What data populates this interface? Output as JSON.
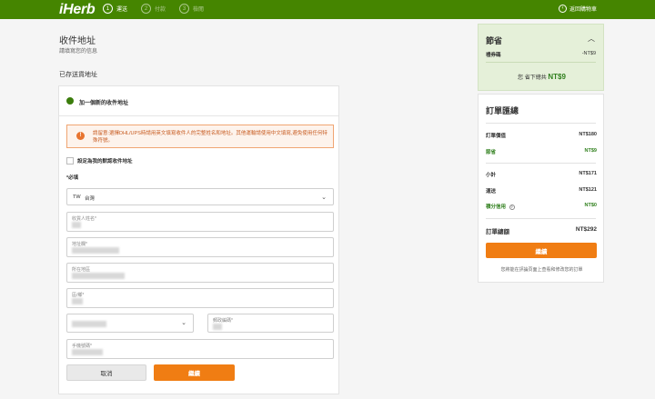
{
  "header": {
    "logo": "iHerb",
    "steps": [
      {
        "num": "1",
        "label": "運送"
      },
      {
        "num": "2",
        "label": "付款"
      },
      {
        "num": "3",
        "label": "檢閱"
      }
    ],
    "back_icon": "‹",
    "back_label": "返回購物車"
  },
  "page": {
    "title": "收件地址",
    "subtitle": "請填寫您的信息",
    "saved_label": "已存送貨地址"
  },
  "form": {
    "add_new_label": "加一個新的收件地址",
    "notice_icon": "!",
    "notice_text": "請留意:選擇DHL/UPS時請用英文填寫收件人的完整姓名和地址。其他運輸請使用中文填寫,避免使用任何特殊符號。",
    "default_label": "設定為我的默認收件地址",
    "required_label": "*必填",
    "country_code": "TW",
    "country_name": "台灣",
    "fields": {
      "recipient": "收貨人姓名*",
      "address1": "地址欄*",
      "address2": "所在地區",
      "district": "區/鄉*",
      "postal": "郵政編碼*",
      "phone": "手機號碼*"
    },
    "cancel_label": "取消",
    "continue_label": "繼續"
  },
  "savings": {
    "title": "節省",
    "caret": "︿",
    "coupon_label": "禮券碼",
    "coupon_value": "-NT$9",
    "total_prefix": "您 省下總共",
    "total_value": "NT$9"
  },
  "summary": {
    "title": "訂單匯總",
    "rows": [
      {
        "label": "訂單價值",
        "value": "NT$180"
      },
      {
        "label": "節省",
        "value": "NT$9"
      },
      {
        "label": "小計",
        "value": "NT$171"
      },
      {
        "label": "運送",
        "value": "NT$121"
      },
      {
        "label": "積分信用",
        "value": "NT$0"
      },
      {
        "label": "訂單總額",
        "value": "NT$292"
      }
    ],
    "continue_label": "繼續",
    "note": "您將能在評論頁面上查看和修改您的訂單"
  },
  "colors": {
    "brand_green": "#458500",
    "accent_orange": "#f07d13",
    "savings_green": "#2f7f1c"
  }
}
